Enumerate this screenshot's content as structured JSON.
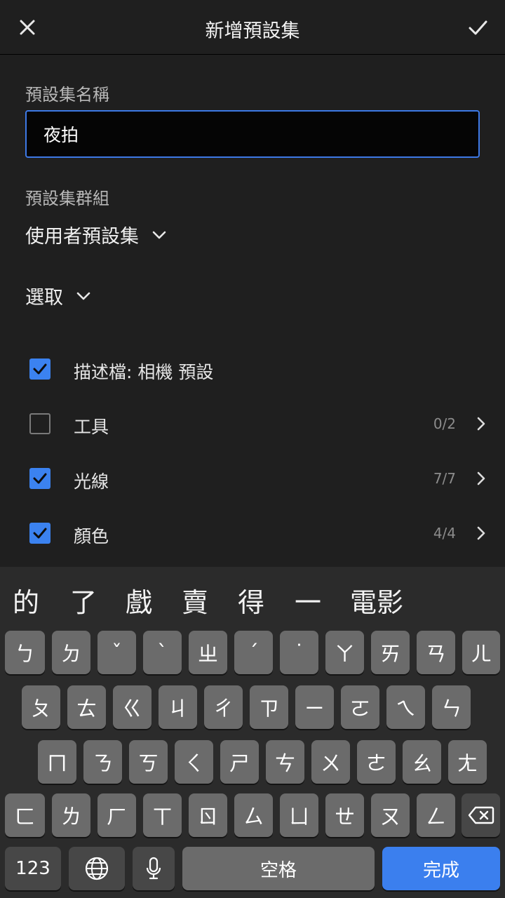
{
  "header": {
    "title": "新增預設集"
  },
  "form": {
    "name_label": "預設集名稱",
    "name_value": "夜拍",
    "group_label": "預設集群組",
    "group_value": "使用者預設集",
    "select_label": "選取"
  },
  "items": [
    {
      "label": "描述檔: 相機 預設",
      "checked": true,
      "count": ""
    },
    {
      "label": "工具",
      "checked": false,
      "count": "0/2"
    },
    {
      "label": "光線",
      "checked": true,
      "count": "7/7"
    },
    {
      "label": "顏色",
      "checked": true,
      "count": "4/4"
    }
  ],
  "keyboard": {
    "candidates": [
      "的",
      "了",
      "戲",
      "賣",
      "得",
      "一",
      "電影"
    ],
    "row1": [
      "ㄅ",
      "ㄉ",
      "ˇ",
      "ˋ",
      "ㄓ",
      "ˊ",
      "˙",
      "ㄚ",
      "ㄞ",
      "ㄢ",
      "ㄦ"
    ],
    "row2": [
      "ㄆ",
      "ㄊ",
      "ㄍ",
      "ㄐ",
      "ㄔ",
      "ㄗ",
      "ㄧ",
      "ㄛ",
      "ㄟ",
      "ㄣ"
    ],
    "row3": [
      "ㄇ",
      "ㄋ",
      "ㄎ",
      "ㄑ",
      "ㄕ",
      "ㄘ",
      "ㄨ",
      "ㄜ",
      "ㄠ",
      "ㄤ"
    ],
    "row4": [
      "ㄈ",
      "ㄌ",
      "ㄏ",
      "ㄒ",
      "ㄖ",
      "ㄙ",
      "ㄩ",
      "ㄝ",
      "ㄡ",
      "ㄥ"
    ],
    "numbers_label": "123",
    "space_label": "空格",
    "done_label": "完成"
  },
  "colors": {
    "accent": "#3b82f0",
    "background": "#1f1f1f",
    "keyboard": "#2b2b2b"
  },
  "icons": {
    "close": "close-icon",
    "confirm": "checkmark-icon",
    "globe": "globe-icon",
    "mic": "microphone-icon",
    "delete": "backspace-icon"
  }
}
